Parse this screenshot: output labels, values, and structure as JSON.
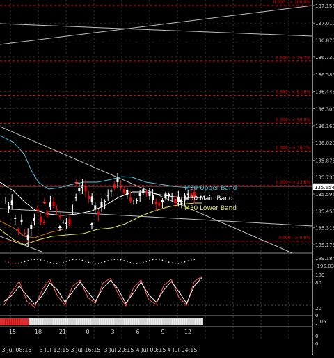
{
  "chart_data": [
    {
      "type": "candlestick",
      "panel": "price",
      "price_axis_ticks": [
        "137.155",
        "137.010",
        "136.870",
        "136.730",
        "136.585",
        "136.445",
        "136.300",
        "136.160",
        "136.020",
        "135.875",
        "135.735",
        "135.595",
        "135.455",
        "135.315",
        "135.175"
      ],
      "current_price": "135.654",
      "fib_levels": [
        {
          "label": "0.000 --> 100.0%",
          "price": 137.155
        },
        {
          "label": "0.000 --> 76.4%",
          "price": 136.695
        },
        {
          "label": "0.000 --> 61.8%",
          "price": 136.41
        },
        {
          "label": "0.000 --> 50.0%",
          "price": 136.18
        },
        {
          "label": "0.000 --> 38.2%",
          "price": 135.95
        },
        {
          "label": "0.000 --> 23.6%",
          "price": 135.665
        },
        {
          "label": "0.000 --> 0.0%",
          "price": 135.205
        }
      ],
      "band_labels": {
        "upper": "M30 Upper Band",
        "main": "M30 Main Band",
        "lower": "M30 Lower Band"
      },
      "colors": {
        "up": "#ffffff",
        "down": "#ff0000",
        "upper_band": "#4fc3d9",
        "main_band": "#ffffff",
        "lower_band": "#e8e85a",
        "fib": "#ff0000",
        "trendline": "#c0c0c0"
      }
    },
    {
      "type": "line",
      "panel": "oscillator-1",
      "axis_ticks": [
        "189.1845",
        "-195.0375"
      ]
    },
    {
      "type": "line",
      "panel": "stochastic",
      "axis_ticks": [
        "100",
        "80",
        "20",
        "0"
      ],
      "series": [
        {
          "color": "#ff5a5a",
          "values": [
            20,
            55,
            82,
            30,
            15,
            60,
            88,
            45,
            20,
            70,
            85,
            40,
            25,
            78,
            90,
            50,
            18,
            65,
            86,
            35,
            22,
            72,
            88,
            40,
            20,
            82,
            95
          ]
        },
        {
          "color": "#ffffff",
          "values": [
            30,
            45,
            70,
            45,
            22,
            45,
            78,
            60,
            28,
            55,
            80,
            55,
            30,
            65,
            85,
            62,
            25,
            52,
            80,
            48,
            28,
            60,
            82,
            55,
            25,
            70,
            92
          ]
        }
      ]
    },
    {
      "type": "bar",
      "panel": "progress",
      "fill_fraction": 0.14,
      "axis_ticks": [
        "1.05",
        "1",
        "0",
        "0"
      ]
    }
  ],
  "time_axis": {
    "top_labels": [
      "15",
      "18",
      "21",
      "0",
      "3",
      "6",
      "9",
      "12"
    ],
    "bottom_labels": [
      "3 Jul 08:15",
      "3 Jul 12:15",
      "3 Jul 16:15",
      "3 Jul 20:15",
      "4 Jul 00:15",
      "4 Jul 04:15"
    ]
  }
}
